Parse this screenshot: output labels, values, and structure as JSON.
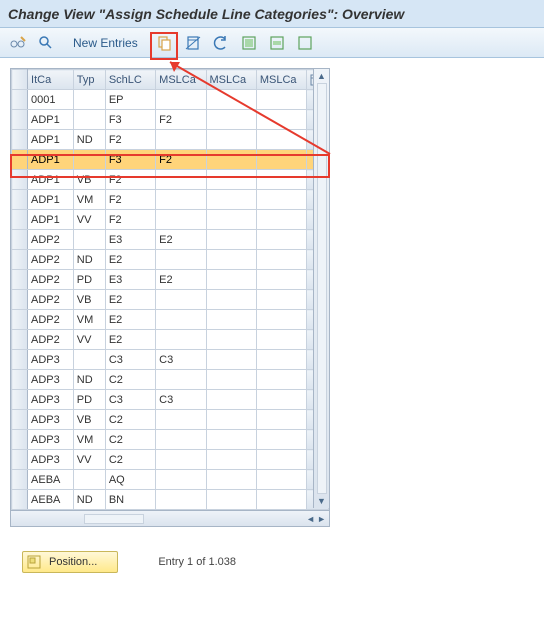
{
  "title": "Change View \"Assign Schedule Line Categories\": Overview",
  "toolbar": {
    "new_entries_label": "New Entries"
  },
  "table": {
    "columns": [
      "ItCa",
      "Typ",
      "SchLC",
      "MSLCa",
      "MSLCa",
      "MSLCa"
    ],
    "config_icon": "configure-columns-icon",
    "rows": [
      {
        "itca": "0001",
        "typ": "",
        "schlc": "EP",
        "m1": "",
        "m2": "",
        "m3": "",
        "highlight": false
      },
      {
        "itca": "ADP1",
        "typ": "",
        "schlc": "F3",
        "m1": "F2",
        "m2": "",
        "m3": "",
        "highlight": false
      },
      {
        "itca": "ADP1",
        "typ": "ND",
        "schlc": "F2",
        "m1": "",
        "m2": "",
        "m3": "",
        "highlight": false
      },
      {
        "itca": "ADP1",
        "typ": "",
        "schlc": "F3",
        "m1": "F2",
        "m2": "",
        "m3": "",
        "highlight": true
      },
      {
        "itca": "ADP1",
        "typ": "VB",
        "schlc": "F2",
        "m1": "",
        "m2": "",
        "m3": "",
        "highlight": false
      },
      {
        "itca": "ADP1",
        "typ": "VM",
        "schlc": "F2",
        "m1": "",
        "m2": "",
        "m3": "",
        "highlight": false
      },
      {
        "itca": "ADP1",
        "typ": "VV",
        "schlc": "F2",
        "m1": "",
        "m2": "",
        "m3": "",
        "highlight": false
      },
      {
        "itca": "ADP2",
        "typ": "",
        "schlc": "E3",
        "m1": "E2",
        "m2": "",
        "m3": "",
        "highlight": false
      },
      {
        "itca": "ADP2",
        "typ": "ND",
        "schlc": "E2",
        "m1": "",
        "m2": "",
        "m3": "",
        "highlight": false
      },
      {
        "itca": "ADP2",
        "typ": "PD",
        "schlc": "E3",
        "m1": "E2",
        "m2": "",
        "m3": "",
        "highlight": false
      },
      {
        "itca": "ADP2",
        "typ": "VB",
        "schlc": "E2",
        "m1": "",
        "m2": "",
        "m3": "",
        "highlight": false
      },
      {
        "itca": "ADP2",
        "typ": "VM",
        "schlc": "E2",
        "m1": "",
        "m2": "",
        "m3": "",
        "highlight": false
      },
      {
        "itca": "ADP2",
        "typ": "VV",
        "schlc": "E2",
        "m1": "",
        "m2": "",
        "m3": "",
        "highlight": false
      },
      {
        "itca": "ADP3",
        "typ": "",
        "schlc": "C3",
        "m1": "C3",
        "m2": "",
        "m3": "",
        "highlight": false
      },
      {
        "itca": "ADP3",
        "typ": "ND",
        "schlc": "C2",
        "m1": "",
        "m2": "",
        "m3": "",
        "highlight": false
      },
      {
        "itca": "ADP3",
        "typ": "PD",
        "schlc": "C3",
        "m1": "C3",
        "m2": "",
        "m3": "",
        "highlight": false
      },
      {
        "itca": "ADP3",
        "typ": "VB",
        "schlc": "C2",
        "m1": "",
        "m2": "",
        "m3": "",
        "highlight": false
      },
      {
        "itca": "ADP3",
        "typ": "VM",
        "schlc": "C2",
        "m1": "",
        "m2": "",
        "m3": "",
        "highlight": false
      },
      {
        "itca": "ADP3",
        "typ": "VV",
        "schlc": "C2",
        "m1": "",
        "m2": "",
        "m3": "",
        "highlight": false
      },
      {
        "itca": "AEBA",
        "typ": "",
        "schlc": "AQ",
        "m1": "",
        "m2": "",
        "m3": "",
        "highlight": false
      },
      {
        "itca": "AEBA",
        "typ": "ND",
        "schlc": "BN",
        "m1": "",
        "m2": "",
        "m3": "",
        "highlight": false
      }
    ]
  },
  "footer": {
    "position_label": "Position...",
    "entry_info": "Entry 1 of 1.038"
  }
}
